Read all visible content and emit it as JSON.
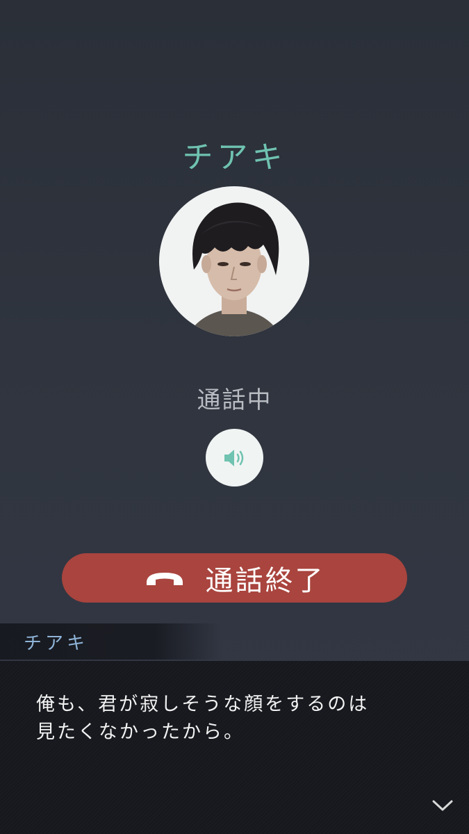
{
  "call": {
    "caller_name": "チアキ",
    "status": "通話中",
    "end_call_label": "通話終了",
    "avatar_icon": "portrait-avatar",
    "speaker_icon": "speaker-icon",
    "end_call_icon": "phone-hangup-icon"
  },
  "dialogue": {
    "speaker": "チアキ",
    "lines": [
      "俺も、君が寂しそうな顔をするのは",
      "見たくなかったから。"
    ],
    "next_icon": "chevron-down-icon"
  },
  "colors": {
    "accent": "#6fc3b0",
    "end_call": "#a9443e",
    "speaker_name": "#8fb4d8"
  }
}
